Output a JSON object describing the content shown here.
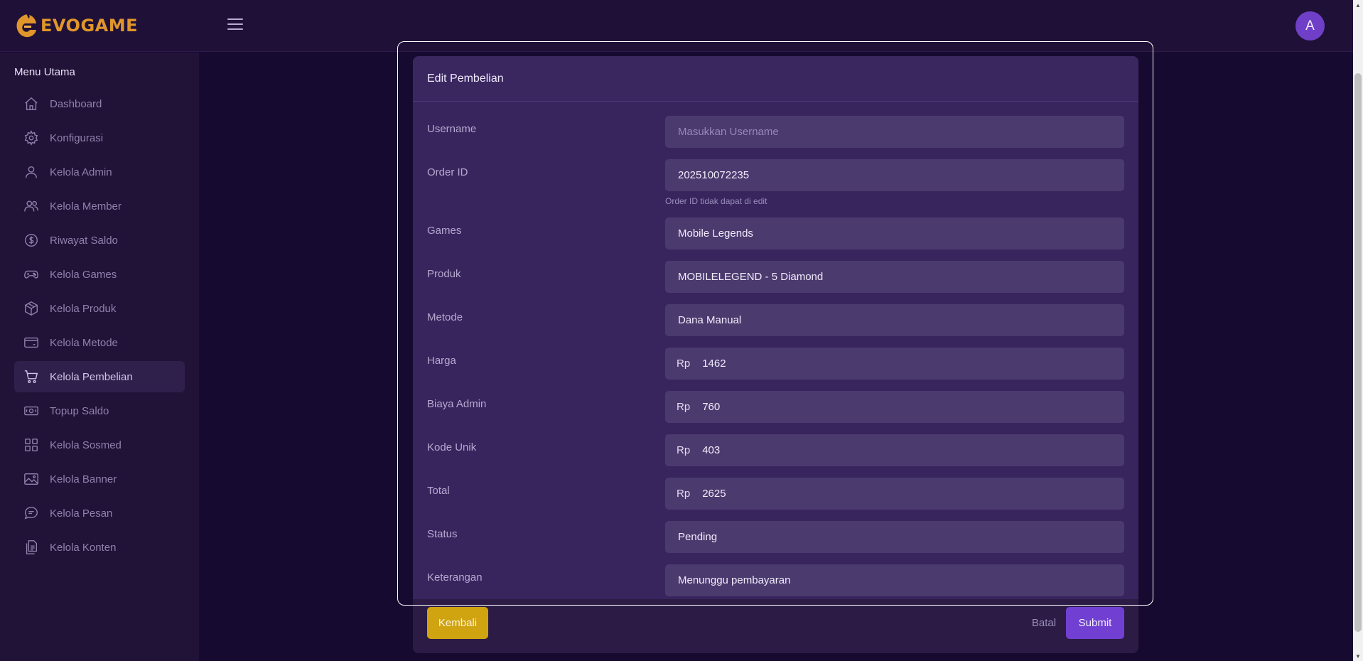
{
  "brand": {
    "name": "EVOGAME",
    "logo_icon": "flame-e-logo"
  },
  "header": {
    "avatar_letter": "A"
  },
  "sidebar": {
    "title": "Menu Utama",
    "items": [
      {
        "label": "Dashboard",
        "icon": "home-icon"
      },
      {
        "label": "Konfigurasi",
        "icon": "gear-icon"
      },
      {
        "label": "Kelola Admin",
        "icon": "user-icon"
      },
      {
        "label": "Kelola Member",
        "icon": "users-icon"
      },
      {
        "label": "Riwayat Saldo",
        "icon": "dollar-circle-icon"
      },
      {
        "label": "Kelola Games",
        "icon": "gamepad-icon"
      },
      {
        "label": "Kelola Produk",
        "icon": "box-icon"
      },
      {
        "label": "Kelola Metode",
        "icon": "card-icon"
      },
      {
        "label": "Kelola Pembelian",
        "icon": "cart-icon",
        "active": true
      },
      {
        "label": "Topup Saldo",
        "icon": "cash-icon"
      },
      {
        "label": "Kelola Sosmed",
        "icon": "grid-icon"
      },
      {
        "label": "Kelola Banner",
        "icon": "image-icon"
      },
      {
        "label": "Kelola Pesan",
        "icon": "message-icon"
      },
      {
        "label": "Kelola Konten",
        "icon": "document-icon"
      }
    ]
  },
  "form": {
    "title": "Edit Pembelian",
    "currency_prefix": "Rp",
    "username": {
      "label": "Username",
      "placeholder": "Masukkan Username"
    },
    "order_id": {
      "label": "Order ID",
      "value": "202510072235",
      "help": "Order ID tidak dapat di edit"
    },
    "games": {
      "label": "Games",
      "value": "Mobile Legends"
    },
    "produk": {
      "label": "Produk",
      "value": "MOBILELEGEND - 5 Diamond"
    },
    "metode": {
      "label": "Metode",
      "value": "Dana Manual"
    },
    "harga": {
      "label": "Harga",
      "value": "1462"
    },
    "biaya_admin": {
      "label": "Biaya Admin",
      "value": "760"
    },
    "kode_unik": {
      "label": "Kode Unik",
      "value": "403"
    },
    "total": {
      "label": "Total",
      "value": "2625"
    },
    "status": {
      "label": "Status",
      "value": "Pending"
    },
    "keterangan": {
      "label": "Keterangan",
      "value": "Menunggu pembayaran"
    }
  },
  "footer": {
    "back_label": "Kembali",
    "cancel_label": "Batal",
    "submit_label": "Submit"
  },
  "colors": {
    "accent": "#7140d2",
    "brand": "#e0962a",
    "back_button": "#d0a311",
    "background": "#170a30"
  }
}
